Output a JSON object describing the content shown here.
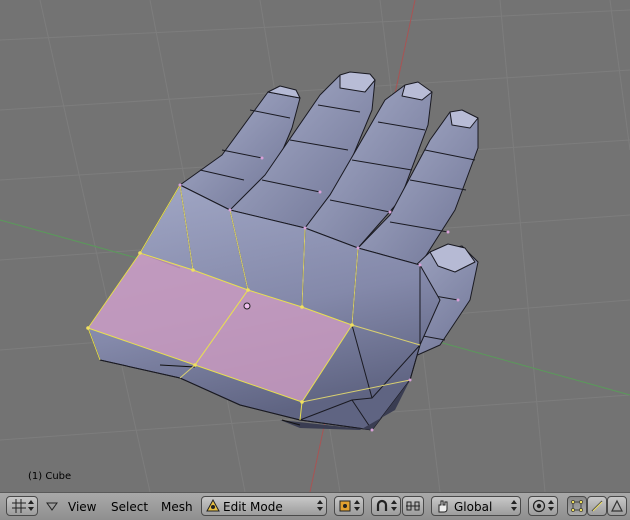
{
  "viewport": {
    "object_info": "(1) Cube"
  },
  "toolbar": {
    "view_menu": "View",
    "select_menu": "Select",
    "mesh_menu": "Mesh",
    "mode_select": {
      "value": "Edit Mode"
    },
    "orientation_select": {
      "value": "Global"
    }
  },
  "colors": {
    "viewport_bg": "#737373",
    "mesh_fill": "#8a90b0",
    "selected_face": "#c99ac0",
    "selected_edge": "#e8e050",
    "x_axis": "#b05050",
    "y_axis": "#58a058"
  },
  "icons": [
    "editor-type-grid-icon",
    "header-collapse-triangle-icon",
    "mode-icon",
    "pivot-point-icon",
    "manipulator-toggle-icon",
    "manipulator-mode-icon",
    "hand-transform-icon",
    "proportional-edit-icon",
    "vertex-select-icon",
    "edge-select-icon",
    "face-select-icon"
  ]
}
